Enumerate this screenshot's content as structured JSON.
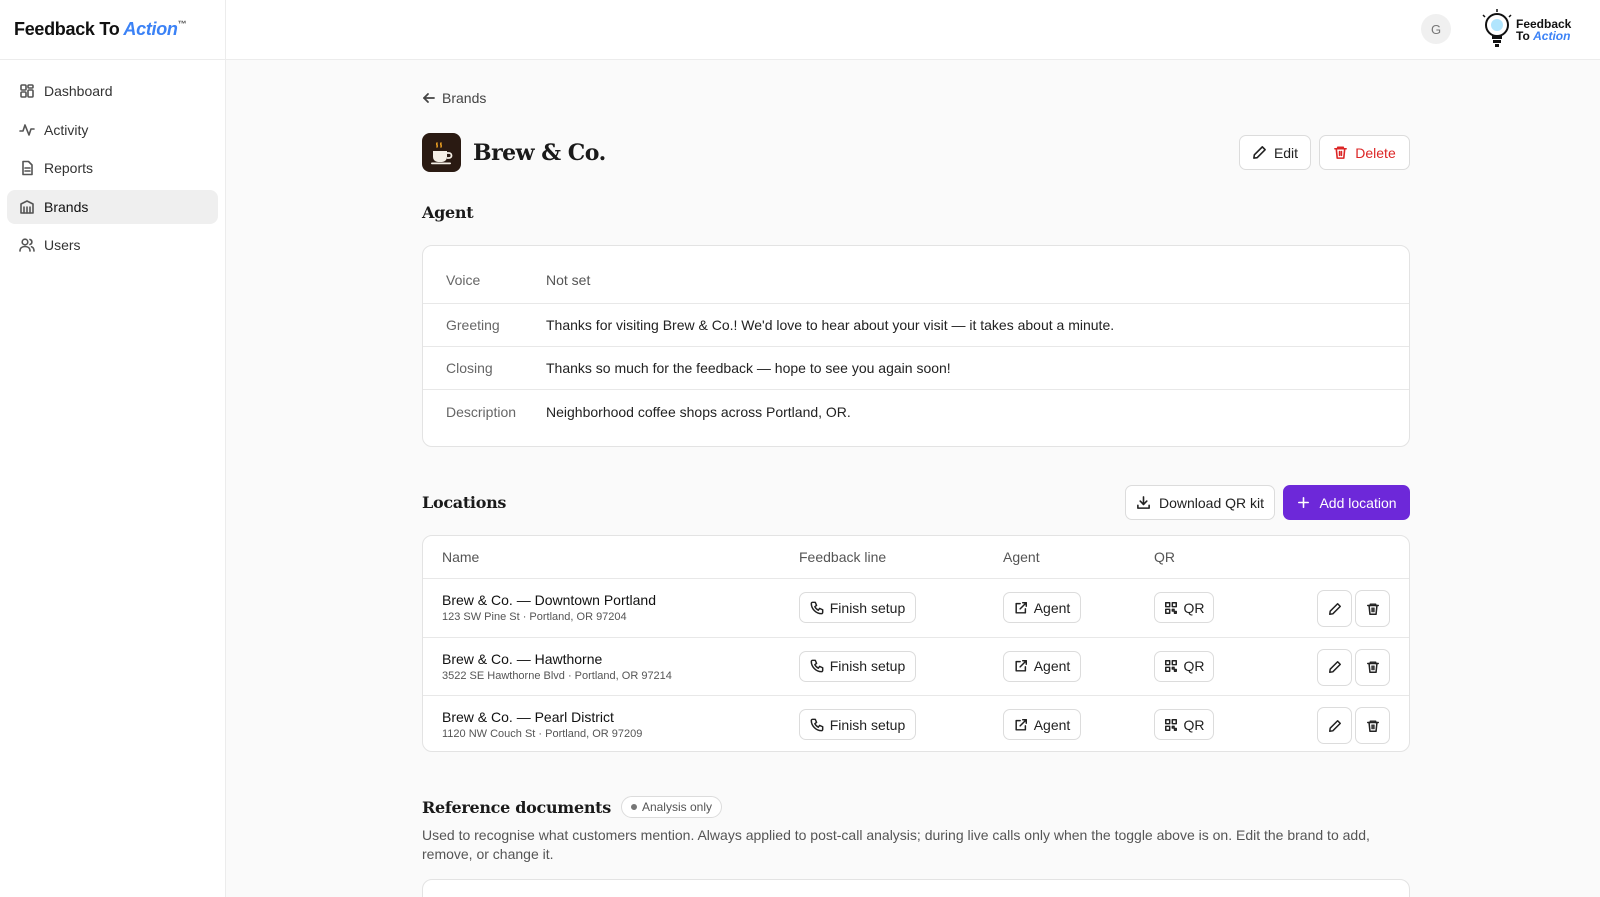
{
  "app": {
    "logo_main": "Feedback To",
    "logo_accent": "Action",
    "logo_tm": "™"
  },
  "sidebar": {
    "items": [
      {
        "label": "Dashboard",
        "icon": "dashboard-icon"
      },
      {
        "label": "Activity",
        "icon": "activity-icon"
      },
      {
        "label": "Reports",
        "icon": "reports-icon"
      },
      {
        "label": "Brands",
        "icon": "brands-icon",
        "active": true
      },
      {
        "label": "Users",
        "icon": "users-icon"
      }
    ]
  },
  "header": {
    "avatar_initial": "G",
    "brand_logo_line1": "Feedback",
    "brand_logo_line2a": "To",
    "brand_logo_line2b": "Action"
  },
  "page": {
    "back_label": "Brands",
    "brand_name": "Brew & Co.",
    "edit_label": "Edit",
    "delete_label": "Delete"
  },
  "agent": {
    "title": "Agent",
    "rows": [
      {
        "label": "Voice",
        "value": "Not set"
      },
      {
        "label": "Greeting",
        "value": "Thanks for visiting Brew & Co.! We'd love to hear about your visit — it takes about a minute."
      },
      {
        "label": "Closing",
        "value": "Thanks so much for the feedback — hope to see you again soon!"
      },
      {
        "label": "Description",
        "value": "Neighborhood coffee shops across Portland, OR."
      }
    ]
  },
  "locations": {
    "title": "Locations",
    "download_label": "Download QR kit",
    "add_label": "Add location",
    "columns": {
      "name": "Name",
      "feedback": "Feedback line",
      "agent": "Agent",
      "qr": "QR"
    },
    "rows": [
      {
        "name": "Brew & Co. — Downtown Portland",
        "address": "123 SW Pine St · Portland, OR 97204",
        "finish": "Finish setup",
        "agent": "Agent",
        "qr": "QR"
      },
      {
        "name": "Brew & Co. — Hawthorne",
        "address": "3522 SE Hawthorne Blvd · Portland, OR 97214",
        "finish": "Finish setup",
        "agent": "Agent",
        "qr": "QR"
      },
      {
        "name": "Brew & Co. — Pearl District",
        "address": "1120 NW Couch St · Portland, OR 97209",
        "finish": "Finish setup",
        "agent": "Agent",
        "qr": "QR"
      }
    ]
  },
  "reference": {
    "title": "Reference documents",
    "badge": "Analysis only",
    "description": "Used to recognise what customers mention. Always applied to post-call analysis; during live calls only when the toggle above is on. Edit the brand to add, remove, or change it."
  },
  "colors": {
    "accent": "#6d28d9",
    "danger": "#dc2626",
    "logo_accent": "#3b82f6"
  }
}
